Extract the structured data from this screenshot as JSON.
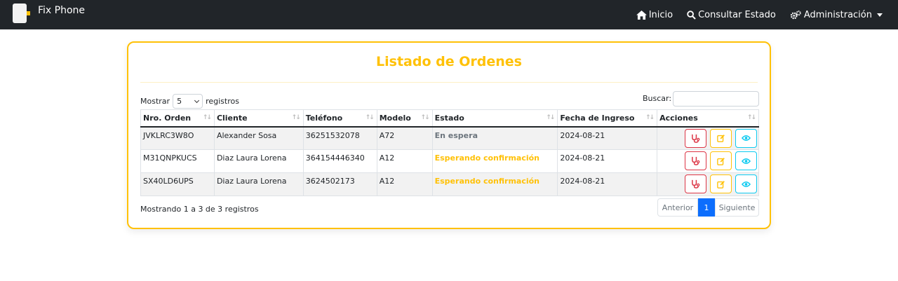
{
  "navbar": {
    "brand": "Fix Phone",
    "items": [
      {
        "label": "Inicio",
        "icon": "home-icon"
      },
      {
        "label": "Consultar Estado",
        "icon": "search-icon"
      },
      {
        "label": "Administración",
        "icon": "gears-icon"
      }
    ]
  },
  "card": {
    "title": "Listado de Ordenes",
    "length_prefix": "Mostrar",
    "length_value": "5",
    "length_suffix": "registros",
    "search_label": "Buscar:",
    "search_value": ""
  },
  "table": {
    "columns": [
      "Nro. Orden",
      "Cliente",
      "Teléfono",
      "Modelo",
      "Estado",
      "Fecha de Ingreso",
      "Acciones"
    ],
    "rows": [
      {
        "orden": "JVKLRC3W8O",
        "cliente": "Alexander Sosa",
        "telefono": "36251532078",
        "modelo": "A72",
        "estado": "En espera",
        "fecha": "2024-08-21"
      },
      {
        "orden": "M31QNPKUCS",
        "cliente": "Diaz Laura Lorena",
        "telefono": "364154446340",
        "modelo": "A12",
        "estado": "Esperando confirmación",
        "fecha": "2024-08-21"
      },
      {
        "orden": "SX40LD6UPS",
        "cliente": "Diaz Laura Lorena",
        "telefono": "3624502173",
        "modelo": "A12",
        "estado": "Esperando confirmación",
        "fecha": "2024-08-21"
      }
    ]
  },
  "footer": {
    "info": "Mostrando 1 a 3 de 3 registros",
    "prev": "Anterior",
    "page": "1",
    "next": "Siguiente"
  },
  "colors": {
    "accent": "#ffc107",
    "navbar": "#212529",
    "primary": "#0d6efd",
    "danger": "#dc3545",
    "info": "#0dcaf0"
  }
}
